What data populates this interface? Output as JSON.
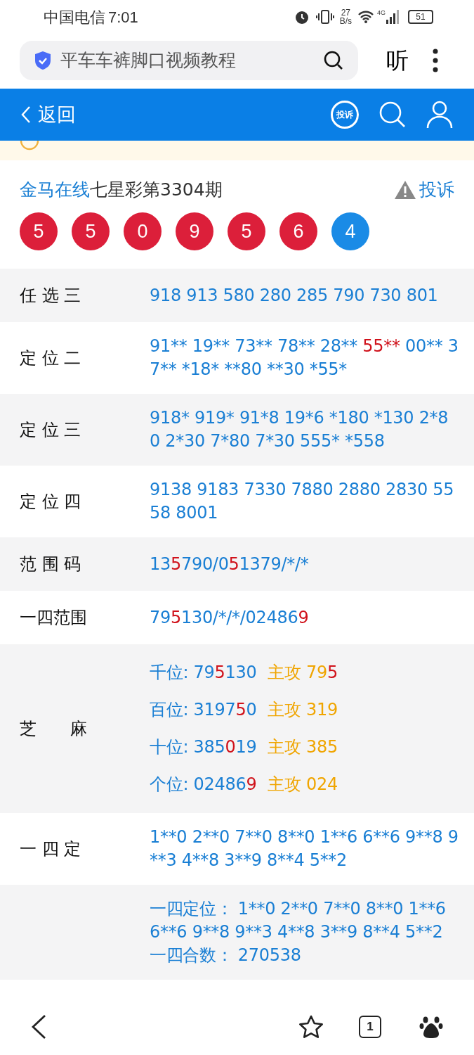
{
  "status_bar": {
    "carrier": "中国电信",
    "time": "7:01",
    "speed": "27",
    "speed_unit": "B/s",
    "network": "4G",
    "battery": "51"
  },
  "browser": {
    "search_text": "平车车裤脚口视频教程",
    "listen": "听"
  },
  "header": {
    "back": "返回",
    "complain_badge": "投诉"
  },
  "title": {
    "source": "金马在线",
    "issue": "七星彩第3304期",
    "complain": "投诉"
  },
  "balls": [
    {
      "number": "5",
      "color": "#dc1f3a"
    },
    {
      "number": "5",
      "color": "#dc1f3a"
    },
    {
      "number": "0",
      "color": "#dc1f3a"
    },
    {
      "number": "9",
      "color": "#dc1f3a"
    },
    {
      "number": "5",
      "color": "#dc1f3a"
    },
    {
      "number": "6",
      "color": "#dc1f3a"
    },
    {
      "number": "4",
      "color": "#1a8be6"
    }
  ],
  "rows": [
    {
      "label": "任 选 三",
      "lines": [
        [
          {
            "text": "918 913 580 280 285 790 730 801",
            "color": "#1a7fd4"
          }
        ]
      ]
    },
    {
      "label": "定 位 二",
      "lines": [
        [
          {
            "text": "91** 19** 73** 78** 28** ",
            "color": "#1a7fd4"
          },
          {
            "text": "55**",
            "color": "#d0121b"
          },
          {
            "text": " 00** 37** *18* **80 **30 *55*",
            "color": "#1a7fd4"
          }
        ]
      ]
    },
    {
      "label": "定 位 三",
      "lines": [
        [
          {
            "text": "918* 919* 91*8 19*6 *180 *130 2*80 2*30 7*80 7*30 555* *558",
            "color": "#1a7fd4"
          }
        ]
      ]
    },
    {
      "label": "定 位 四",
      "lines": [
        [
          {
            "text": "9138 9183 7330 7880 2880 2830 5558 8001",
            "color": "#1a7fd4"
          }
        ]
      ]
    },
    {
      "label": "范 围 码",
      "lines": [
        [
          {
            "text": "13",
            "color": "#1a7fd4"
          },
          {
            "text": "5",
            "color": "#d0121b"
          },
          {
            "text": "790/0",
            "color": "#1a7fd4"
          },
          {
            "text": "5",
            "color": "#d0121b"
          },
          {
            "text": "1379/*/*",
            "color": "#1a7fd4"
          }
        ]
      ]
    },
    {
      "label": "一四范围",
      "lines": [
        [
          {
            "text": "79",
            "color": "#1a7fd4"
          },
          {
            "text": "5",
            "color": "#d0121b"
          },
          {
            "text": "130/*/*/02486",
            "color": "#1a7fd4"
          },
          {
            "text": "9",
            "color": "#d0121b"
          }
        ]
      ]
    },
    {
      "label": "芝　　麻",
      "lines": [
        [
          {
            "text": "千位: 79",
            "color": "#1a7fd4"
          },
          {
            "text": "5",
            "color": "#d0121b"
          },
          {
            "text": "130",
            "color": "#1a7fd4"
          },
          {
            "text": "主攻 79",
            "color": "#f0a500"
          },
          {
            "text": "5",
            "color": "#d0121b"
          }
        ],
        [
          {
            "text": "百位: 3197",
            "color": "#1a7fd4"
          },
          {
            "text": "5",
            "color": "#d0121b"
          },
          {
            "text": "0",
            "color": "#1a7fd4"
          },
          {
            "text": "主攻 319",
            "color": "#f0a500"
          }
        ],
        [
          {
            "text": "十位: 385",
            "color": "#1a7fd4"
          },
          {
            "text": "0",
            "color": "#d0121b"
          },
          {
            "text": "19",
            "color": "#1a7fd4"
          },
          {
            "text": "主攻 385",
            "color": "#f0a500"
          }
        ],
        [
          {
            "text": "个位: 02486",
            "color": "#1a7fd4"
          },
          {
            "text": "9",
            "color": "#d0121b"
          },
          {
            "text": "主攻 024",
            "color": "#f0a500"
          }
        ]
      ]
    },
    {
      "label": "一 四 定",
      "lines": [
        [
          {
            "text": "1**0 2**0 7**0 8**0 1**6 6**6 9**8 9**3 4**8 3**9 8**4 5**2",
            "color": "#1a7fd4"
          }
        ]
      ]
    },
    {
      "lines": [
        [
          {
            "text": "一四定位：  1**0 2**0 7**0 8**0 1**6 6**6 9**8 9**3 4**8 3**9 8**4 5**2",
            "color": "#1a7fd4"
          }
        ],
        [
          {
            "text": "一四合数：  270538",
            "color": "#1a7fd4"
          }
        ]
      ]
    }
  ],
  "bottom_nav": {
    "tab_count": "1"
  }
}
